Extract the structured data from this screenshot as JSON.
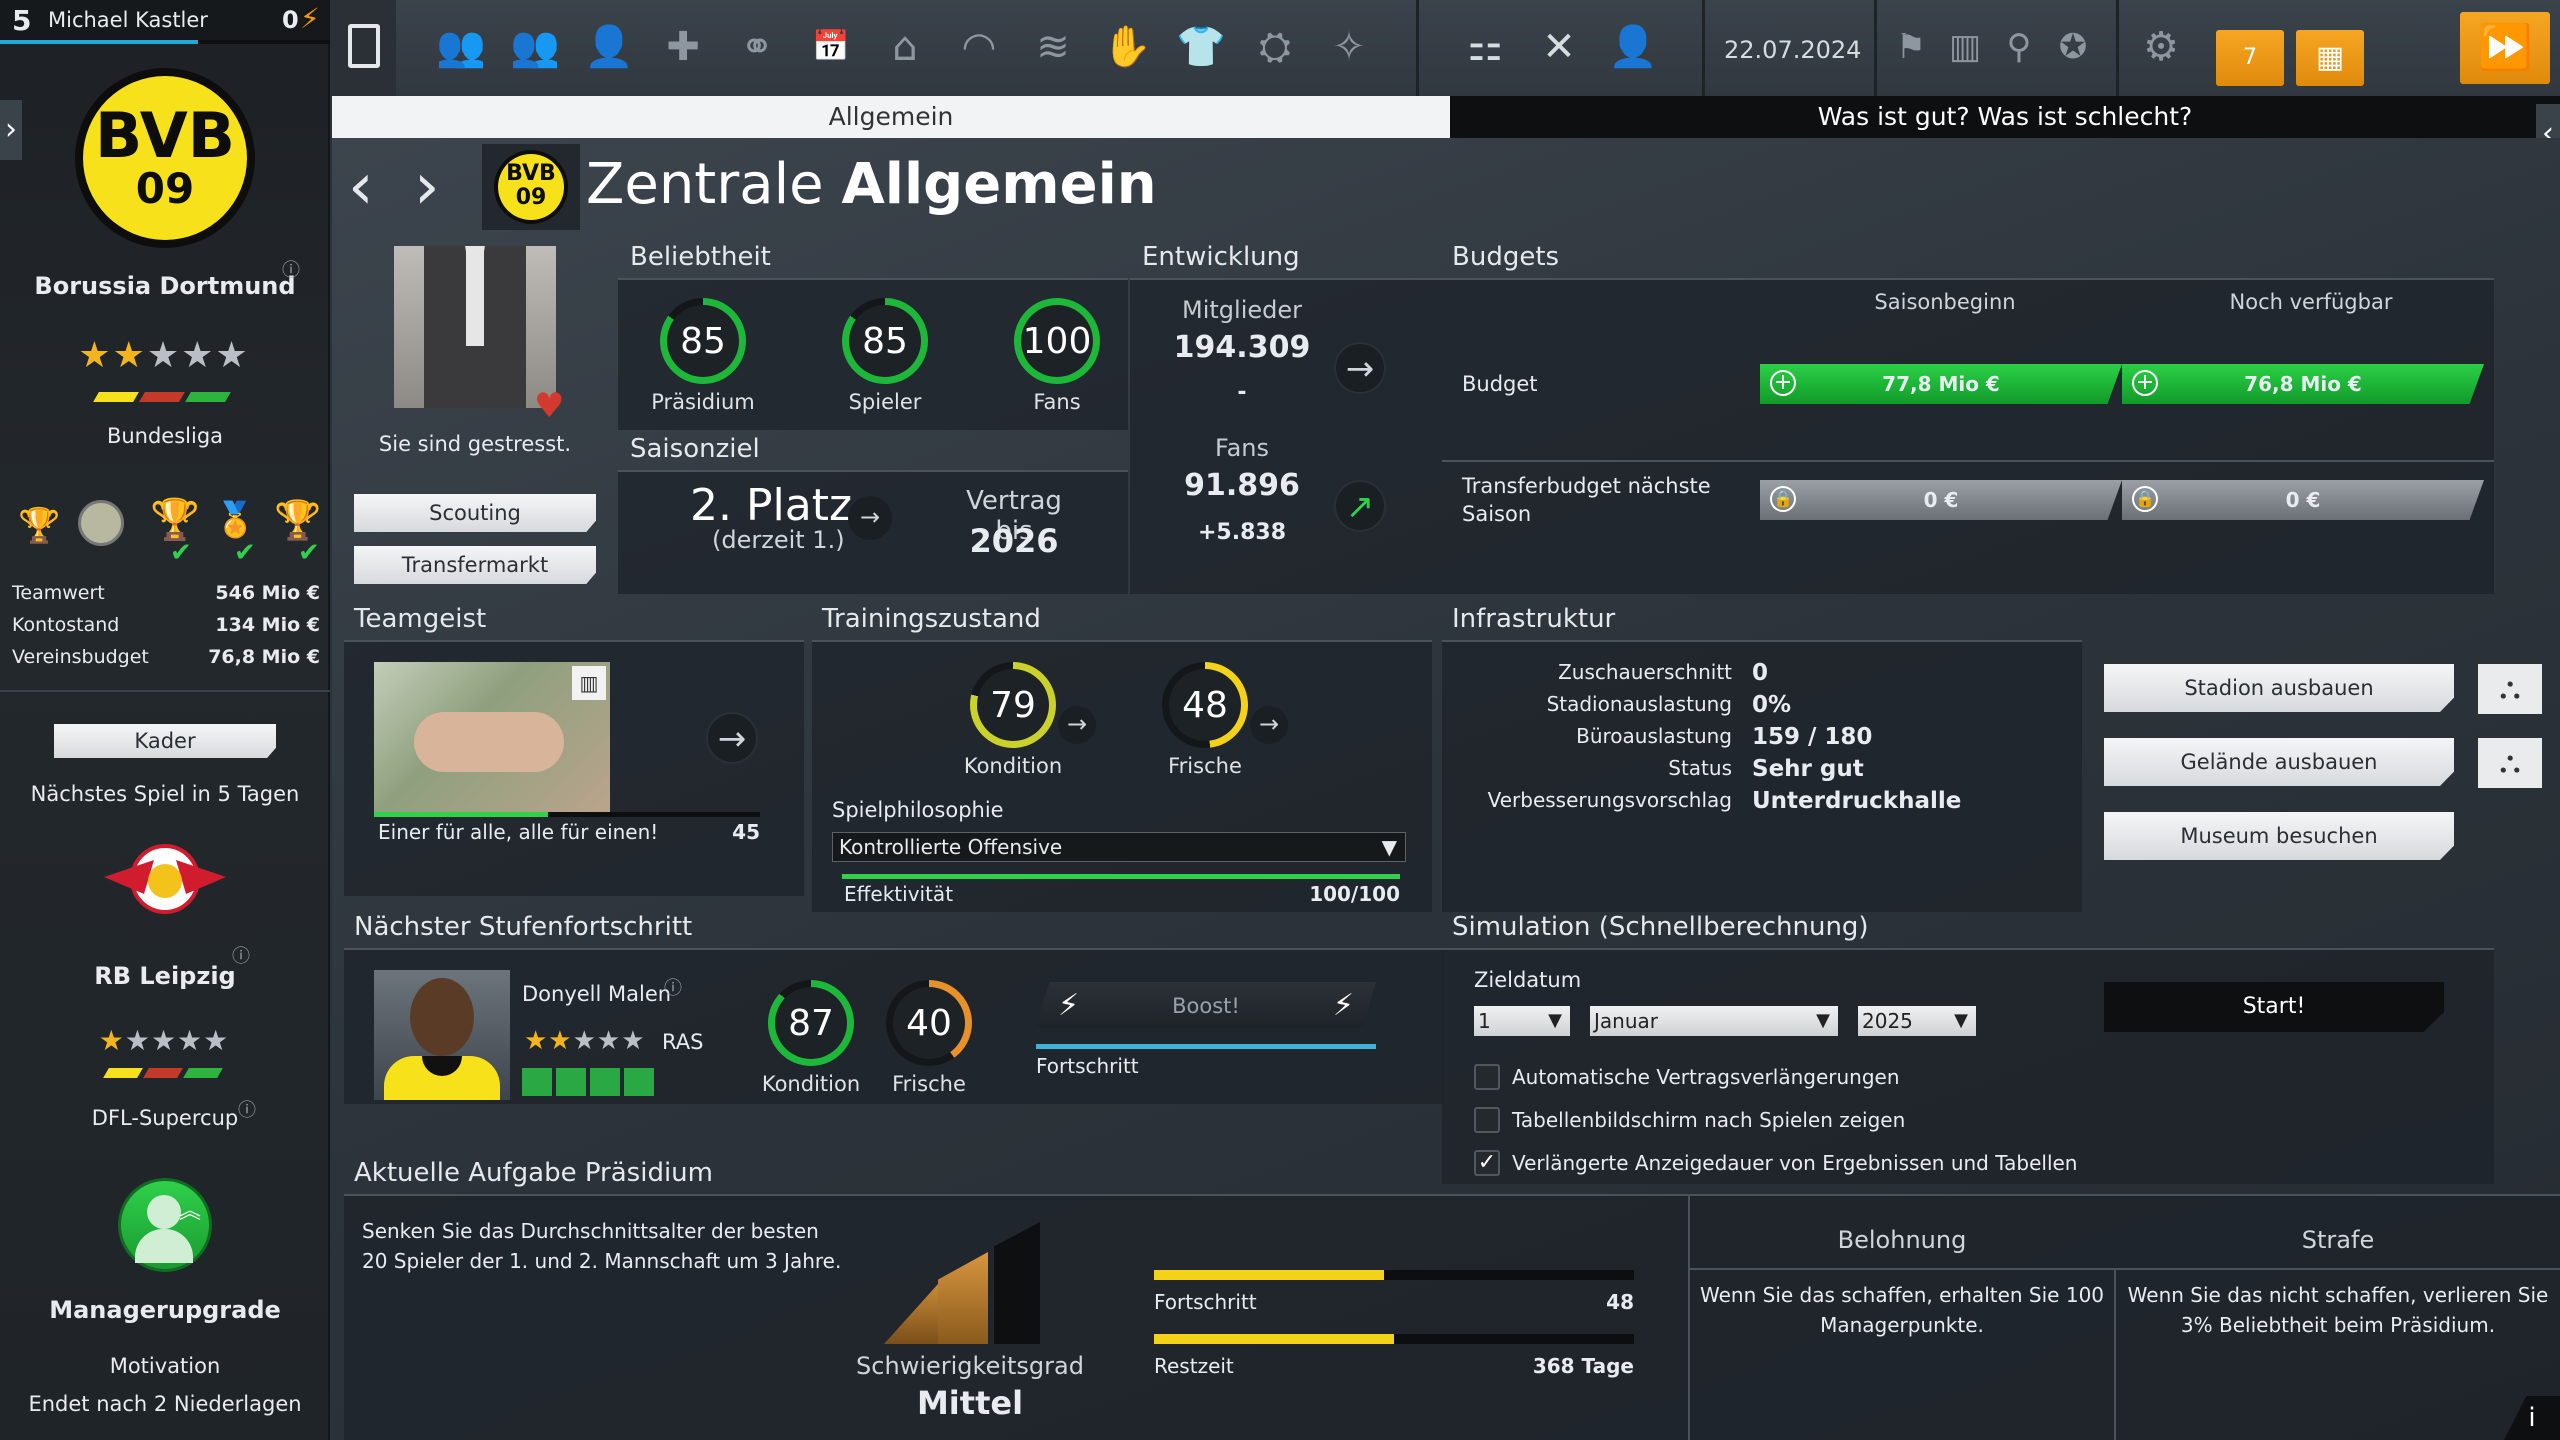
{
  "user": {
    "level": "5",
    "name": "Michael Kastler",
    "points": "0",
    "level_progress": 0.6
  },
  "club": {
    "name": "Borussia Dortmund",
    "league": "Bundesliga",
    "stars_filled": 2,
    "stars_total": 5,
    "logo_text": "BVB",
    "logo_sub": "09"
  },
  "finance": {
    "rows": [
      {
        "label": "Teamwert",
        "value": "546 Mio €"
      },
      {
        "label": "Kontostand",
        "value": "134 Mio €"
      },
      {
        "label": "Vereinsbudget",
        "value": "76,8 Mio €"
      }
    ]
  },
  "sidebar": {
    "kader": "Kader",
    "next_match": "Nächstes Spiel in 5 Tagen",
    "opponent": "RB Leipzig",
    "opponent_stars": 1,
    "cup": "DFL-Supercup",
    "upgrade_title": "Managerupgrade",
    "motivation": "Motivation",
    "motivation_end": "Endet nach 2 Niederlagen"
  },
  "topbar": {
    "date": "22.07.2024",
    "cal1": "7"
  },
  "tabs": {
    "left": "Allgemein",
    "right": "Was ist gut? Was ist schlecht?"
  },
  "header": {
    "title_light": "Zentrale",
    "title_bold": "Allgemein"
  },
  "manager": {
    "status": "Sie sind gestresst.",
    "scouting": "Scouting",
    "transfermarkt": "Transfermarkt"
  },
  "popularity": {
    "title": "Beliebtheit",
    "items": [
      {
        "label": "Präsidium",
        "value": "85",
        "pct": 0.85
      },
      {
        "label": "Spieler",
        "value": "85",
        "pct": 0.85
      },
      {
        "label": "Fans",
        "value": "100",
        "pct": 1.0
      }
    ]
  },
  "season": {
    "title": "Saisonziel",
    "goal": "2. Platz",
    "current": "(derzeit 1.)",
    "contract_label": "Vertrag bis",
    "contract_year": "2026"
  },
  "development": {
    "title": "Entwicklung",
    "members_label": "Mitglieder",
    "members": "194.309",
    "members_delta": "-",
    "fans_label": "Fans",
    "fans": "91.896",
    "fans_delta": "+5.838"
  },
  "budgets": {
    "title": "Budgets",
    "col1": "Saisonbeginn",
    "col2": "Noch verfügbar",
    "budget_label": "Budget",
    "budget_start": "77,8 Mio €",
    "budget_avail": "76,8 Mio €",
    "transfer_label": "Transferbudget nächste Saison",
    "transfer_start": "0 €",
    "transfer_avail": "0 €"
  },
  "teamgeist": {
    "title": "Teamgeist",
    "caption": "Einer für alle, alle für einen!",
    "value": "45",
    "pct": 0.45
  },
  "training": {
    "title": "Trainingszustand",
    "kondition_label": "Kondition",
    "kondition": "79",
    "kondition_pct": 0.79,
    "frische_label": "Frische",
    "frische": "48",
    "frische_pct": 0.48,
    "philosophy_label": "Spielphilosophie",
    "philosophy": "Kontrollierte Offensive",
    "eff_label": "Effektivität",
    "eff_value": "100/100"
  },
  "infra": {
    "title": "Infrastruktur",
    "rows": [
      {
        "label": "Zuschauerschnitt",
        "value": "0"
      },
      {
        "label": "Stadionauslastung",
        "value": "0%"
      },
      {
        "label": "Büroauslastung",
        "value": "159 / 180"
      },
      {
        "label": "Status",
        "value": "Sehr gut"
      },
      {
        "label": "Verbesserungsvorschlag",
        "value": "Unterdruckhalle"
      }
    ],
    "btn1": "Stadion ausbauen",
    "btn2": "Gelände ausbauen",
    "btn3": "Museum besuchen"
  },
  "stufe": {
    "title": "Nächster Stufenfortschritt",
    "player": "Donyell Malen",
    "position": "RAS",
    "kondition_label": "Kondition",
    "kondition": "87",
    "kondition_pct": 0.87,
    "frische_label": "Frische",
    "frische": "40",
    "frische_pct": 0.4,
    "boost": "Boost!",
    "fortschritt": "Fortschritt"
  },
  "sim": {
    "title": "Simulation (Schnellberechnung)",
    "zieldatum": "Zieldatum",
    "day": "1",
    "month": "Januar",
    "year": "2025",
    "start": "Start!",
    "checks": [
      {
        "label": "Automatische Vertragsverlängerungen",
        "checked": false
      },
      {
        "label": "Tabellenbildschirm nach Spielen zeigen",
        "checked": false
      },
      {
        "label": "Verlängerte Anzeigedauer von Ergebnissen und Tabellen",
        "checked": true
      }
    ]
  },
  "task": {
    "title": "Aktuelle Aufgabe Präsidium",
    "text": "Senken Sie das Durchschnittsalter der besten 20 Spieler der 1. und 2. Mannschaft um 3 Jahre.",
    "difficulty_label": "Schwierigkeitsgrad",
    "difficulty": "Mittel",
    "progress_label": "Fortschritt",
    "progress_value": "48",
    "progress_pct": 0.48,
    "rest_label": "Restzeit",
    "rest_value": "368 Tage",
    "rest_pct": 0.5,
    "reward_title": "Belohnung",
    "reward_text": "Wenn Sie das schaffen, erhalten Sie 100 Managerpunkte.",
    "penalty_title": "Strafe",
    "penalty_text": "Wenn Sie das nicht schaffen, verlieren Sie 3% Beliebtheit beim Präsidium."
  },
  "colors": {
    "accent_green": "#1db83a",
    "bvb_yellow": "#f6e11a",
    "orange": "#f0981a",
    "ring_orange": "#e8902a",
    "ring_yellow": "#f3d219"
  }
}
